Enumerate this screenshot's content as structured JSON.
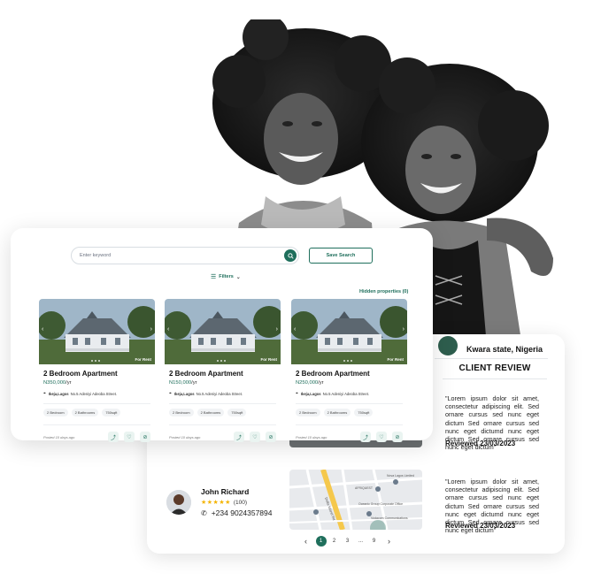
{
  "hero": {
    "alt_subject": "two-smiling-women-photo"
  },
  "search": {
    "placeholder": "Enter keyword",
    "save_label": "Save Search",
    "filters_label": "Filters",
    "hidden_label": "Hidden properties (0)"
  },
  "listings": [
    {
      "badge": "For Rent",
      "title": "2 Bedroom Apartment",
      "price": "N350,000",
      "per": "/yr",
      "area": "Ikeja,Lagos",
      "street": "No.5 Adeniyi Adeoba Street.",
      "chips": [
        "2 Bedroom",
        "2 Bathrooms",
        "750sqft"
      ],
      "posted": "Posted 10 days ago"
    },
    {
      "badge": "For Rent",
      "title": "2 Bedroom Apartment",
      "price": "N150,000",
      "per": "/yr",
      "area": "Ikeja,Lagos",
      "street": "No.5 Adeniyi Adeoba Street.",
      "chips": [
        "2 Bedroom",
        "2 Bathrooms",
        "750sqft"
      ],
      "posted": "Posted 10 days ago"
    },
    {
      "badge": "For Rent",
      "title": "2 Bedroom Apartment",
      "price": "N250,000",
      "per": "/yr",
      "area": "Ikeja,Lagos",
      "street": "No.5 Adeniyi Adeoba Street.",
      "chips": [
        "2 Bedroom",
        "2 Bathrooms",
        "750sqft"
      ],
      "posted": "Posted 10 days ago"
    }
  ],
  "client": {
    "location": "Kwara state, Nigeria",
    "review_heading": "CLIENT REVIEW",
    "reviews": [
      {
        "text": "\"Lorem ipsum dolor sit amet, consectetur adipiscing elit. Sed ornare cursus sed nunc eget dictum Sed ornare cursus sed nunc eget dictumd nunc eget dictum Sed ornare cursus sed nunc eget dictum\"",
        "date": "Reviewed 23/03/2023"
      },
      {
        "text": "\"Lorem ipsum dolor sit amet, consectetur adipiscing elit. Sed ornare cursus sed nunc eget dictum Sed ornare cursus sed nunc eget dictumd nunc eget dictum Sed ornare cursus sed nunc eget dictum\"",
        "date": "Reviewed 23/03/2023"
      }
    ]
  },
  "agent": {
    "name": "John Richard",
    "stars": "★★★★★",
    "rating_count": "(100)",
    "phone": "+234 9024357894"
  },
  "map_labels": [
    "Delta Island Rd",
    "AFRIQUEST",
    "Oceanic Group Corporate Office",
    "Vodacom Communications",
    "Nova Lagos Limited"
  ],
  "pagination": {
    "prev": "‹",
    "pages": [
      "1",
      "2",
      "3",
      "...",
      "9"
    ],
    "next": "›",
    "active": "1"
  },
  "colors": {
    "accent": "#1f6f5c",
    "star": "#f4b400"
  }
}
